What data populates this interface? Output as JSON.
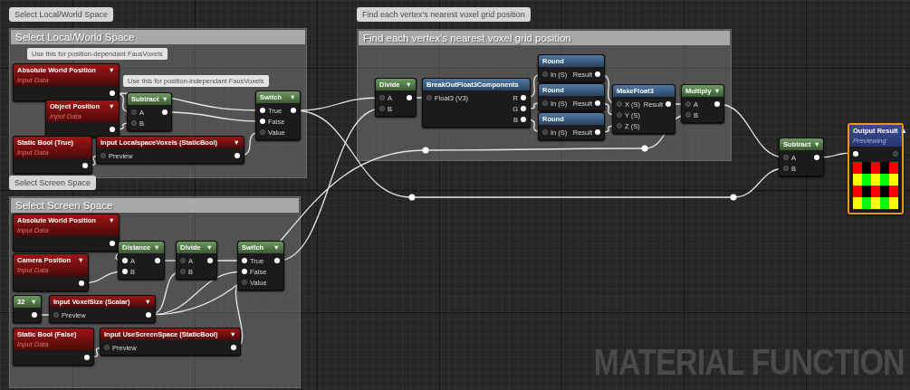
{
  "comments": [
    {
      "bubble": "Select Local/World Space",
      "title": "Select Local/World Space"
    },
    {
      "bubble": "Select Screen Space",
      "title": "Select Screen Space"
    },
    {
      "bubble": "Find each vertex's nearest voxel grid position",
      "title": "Find each vertex's nearest voxel grid position"
    }
  ],
  "notes": [
    "Use this for position-dependant FausVoxels",
    "Use this for position-independant FausVoxels"
  ],
  "nodes": [
    {
      "kind": "input",
      "title": "Absolute World Position",
      "subtitle": "Input Data",
      "caret": "▼",
      "selected": false,
      "rows": [
        {
          "out_linked": true
        }
      ]
    },
    {
      "kind": "input",
      "title": "Object Position",
      "subtitle": "Input Data",
      "caret": "▼",
      "selected": false,
      "rows": [
        {
          "out_linked": true
        }
      ]
    },
    {
      "kind": "input",
      "title": "Static Bool (True)",
      "subtitle": "Input Data",
      "selected": false,
      "rows": [
        {
          "out_linked": true
        }
      ]
    },
    {
      "kind": "math",
      "title": "Subtract",
      "caret": "▼",
      "selected": false,
      "rows": [
        {
          "in": "A",
          "in_linked": false,
          "out_linked": true
        },
        {
          "in": "B",
          "in_linked": false
        }
      ]
    },
    {
      "kind": "parameter",
      "title": "Input LocalspaceVoxels (StaticBool)",
      "caret": "▼",
      "selected": false,
      "rows": [
        {
          "in": "Preview",
          "in_linked": false,
          "out_linked": true
        }
      ]
    },
    {
      "kind": "math",
      "title": "Switch",
      "caret": "▼",
      "selected": false,
      "rows": [
        {
          "in": "True",
          "in_linked": true,
          "out_linked": true
        },
        {
          "in": "False",
          "in_linked": true
        },
        {
          "in": "Value",
          "in_linked": false
        }
      ]
    },
    {
      "kind": "input",
      "title": "Absolute World Position",
      "subtitle": "Input Data",
      "caret": "▼",
      "selected": false,
      "rows": [
        {
          "out_linked": true
        }
      ]
    },
    {
      "kind": "input",
      "title": "Camera Position",
      "subtitle": "Input Data",
      "caret": "▼",
      "selected": false,
      "rows": [
        {
          "out_linked": true
        }
      ]
    },
    {
      "kind": "math",
      "title": "Distance",
      "caret": "▼",
      "selected": false,
      "rows": [
        {
          "in": "A",
          "in_linked": true,
          "out_linked": true
        },
        {
          "in": "B",
          "in_linked": true
        }
      ]
    },
    {
      "kind": "math",
      "title": "Divide",
      "caret": "▼",
      "selected": false,
      "rows": [
        {
          "in": "A",
          "in_linked": false,
          "out_linked": true
        },
        {
          "in": "B",
          "in_linked": false
        }
      ]
    },
    {
      "kind": "math",
      "title": "Switch",
      "caret": "▼",
      "selected": false,
      "rows": [
        {
          "in": "True",
          "in_linked": true,
          "out_linked": true
        },
        {
          "in": "False",
          "in_linked": true
        },
        {
          "in": "Value",
          "in_linked": false
        }
      ]
    },
    {
      "kind": "constant",
      "title": "32",
      "caret": "▼",
      "selected": false,
      "rows": [
        {
          "out_linked": true
        }
      ]
    },
    {
      "kind": "parameter",
      "title": "Input VoxelSize (Scalar)",
      "caret": "▼",
      "selected": false,
      "rows": [
        {
          "in": "Preview",
          "in_linked": false,
          "out_linked": true
        }
      ]
    },
    {
      "kind": "input",
      "title": "Static Bool (False)",
      "subtitle": "Input Data",
      "selected": false,
      "rows": [
        {
          "out_linked": true
        }
      ]
    },
    {
      "kind": "parameter",
      "title": "Input UseScreenSpace (StaticBool)",
      "caret": "▼",
      "selected": false,
      "rows": [
        {
          "in": "Preview",
          "in_linked": false,
          "out_linked": true
        }
      ]
    },
    {
      "kind": "math",
      "title": "Divide",
      "caret": "▼",
      "selected": false,
      "rows": [
        {
          "in": "A",
          "in_linked": false,
          "out_linked": true
        },
        {
          "in": "B",
          "in_linked": false
        }
      ]
    },
    {
      "kind": "function",
      "title": "BreakOutFloat3Components",
      "selected": false,
      "rows": [
        {
          "in": "Float3 (V3)",
          "in_linked": false,
          "out": "R",
          "out_linked": true
        },
        {
          "out": "G",
          "out_linked": true
        },
        {
          "out": "B",
          "out_linked": true
        }
      ]
    },
    {
      "kind": "function",
      "title": "Round",
      "selected": false,
      "rows": [
        {
          "in": "In (S)",
          "in_linked": false,
          "out": "Result",
          "out_linked": true
        }
      ]
    },
    {
      "kind": "function",
      "title": "Round",
      "selected": false,
      "rows": [
        {
          "in": "In (S)",
          "in_linked": false,
          "out": "Result",
          "out_linked": true
        }
      ]
    },
    {
      "kind": "function",
      "title": "Round",
      "selected": false,
      "rows": [
        {
          "in": "In (S)",
          "in_linked": false,
          "out": "Result",
          "out_linked": true
        }
      ]
    },
    {
      "kind": "function",
      "title": "MakeFloat3",
      "selected": false,
      "rows": [
        {
          "in": "X (S)",
          "in_linked": false,
          "out": "Result",
          "out_linked": true
        },
        {
          "in": "Y (S)",
          "in_linked": false
        },
        {
          "in": "Z (S)",
          "in_linked": false
        }
      ]
    },
    {
      "kind": "math",
      "title": "Multiply",
      "caret": "▼",
      "selected": false,
      "rows": [
        {
          "in": "A",
          "in_linked": false,
          "out_linked": true
        },
        {
          "in": "B",
          "in_linked": false
        }
      ]
    },
    {
      "kind": "math",
      "title": "Subtract",
      "caret": "▼",
      "selected": false,
      "rows": [
        {
          "in": "A",
          "in_linked": false,
          "out_linked": true
        },
        {
          "in": "B",
          "in_linked": false
        }
      ]
    },
    {
      "kind": "output",
      "title": "Output Result",
      "subtitle": "Previewing",
      "caret": "▲",
      "selected": true,
      "rows": [
        {
          "in_linked": true,
          "out_linked": false
        }
      ]
    }
  ],
  "graph_label": "MATERIAL FUNCTION"
}
